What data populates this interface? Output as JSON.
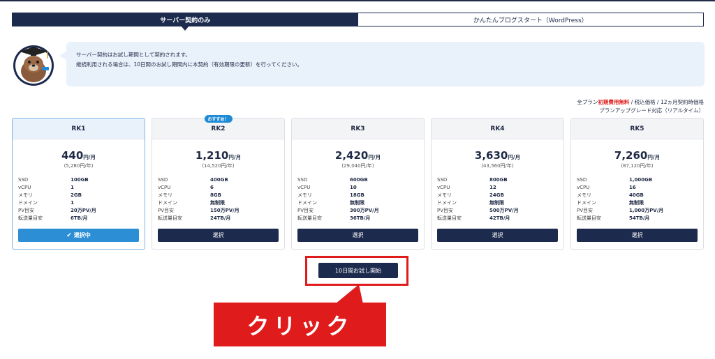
{
  "tabs": [
    {
      "label": "サーバー契約のみ",
      "active": true
    },
    {
      "label": "かんたんブログスタート（WordPress）",
      "active": false
    }
  ],
  "info": {
    "line1": "サーバー契約はお試し期間として契約されます。",
    "line2": "継続利用される場合は、10日間のお試し期間内に本契約（有効期限の更新）を行ってください。"
  },
  "notes": {
    "prefix": "全プラン",
    "highlight": "初期費用無料",
    "suffix": " / 税込価格 / 12ヵ月契約時価格",
    "line2": "プランアップグレード対応（リアルタイム）"
  },
  "spec_labels": [
    "SSD",
    "vCPU",
    "メモリ",
    "ドメイン",
    "PV目安",
    "転送量目安"
  ],
  "plans": [
    {
      "name": "RK1",
      "price": "440",
      "unit": "円/月",
      "yearly": "(5,280円/年)",
      "specs": [
        "100GB",
        "1",
        "2GB",
        "1",
        "20万PV/月",
        "6TB/月"
      ],
      "button": "選択中",
      "selected": true
    },
    {
      "name": "RK2",
      "badge": "おすすめ！",
      "price": "1,210",
      "unit": "円/月",
      "yearly": "(14,520円/年)",
      "specs": [
        "400GB",
        "6",
        "8GB",
        "無制限",
        "150万PV/月",
        "24TB/月"
      ],
      "button": "選択",
      "selected": false
    },
    {
      "name": "RK3",
      "price": "2,420",
      "unit": "円/月",
      "yearly": "(29,040円/年)",
      "specs": [
        "600GB",
        "10",
        "18GB",
        "無制限",
        "300万PV/月",
        "36TB/月"
      ],
      "button": "選択",
      "selected": false
    },
    {
      "name": "RK4",
      "price": "3,630",
      "unit": "円/月",
      "yearly": "(43,560円/年)",
      "specs": [
        "800GB",
        "12",
        "24GB",
        "無制限",
        "500万PV/月",
        "42TB/月"
      ],
      "button": "選択",
      "selected": false
    },
    {
      "name": "RK5",
      "price": "7,260",
      "unit": "円/月",
      "yearly": "(87,120円/年)",
      "specs": [
        "1,000GB",
        "16",
        "40GB",
        "無制限",
        "1,000万PV/月",
        "54TB/月"
      ],
      "button": "選択",
      "selected": false
    }
  ],
  "start_button": "10日間お試し開始",
  "callout": "クリック",
  "colors": {
    "navy": "#1c2a4d",
    "accent_blue": "#2c8fd6",
    "red": "#e01b1b",
    "bubble": "#e9f1fb"
  }
}
